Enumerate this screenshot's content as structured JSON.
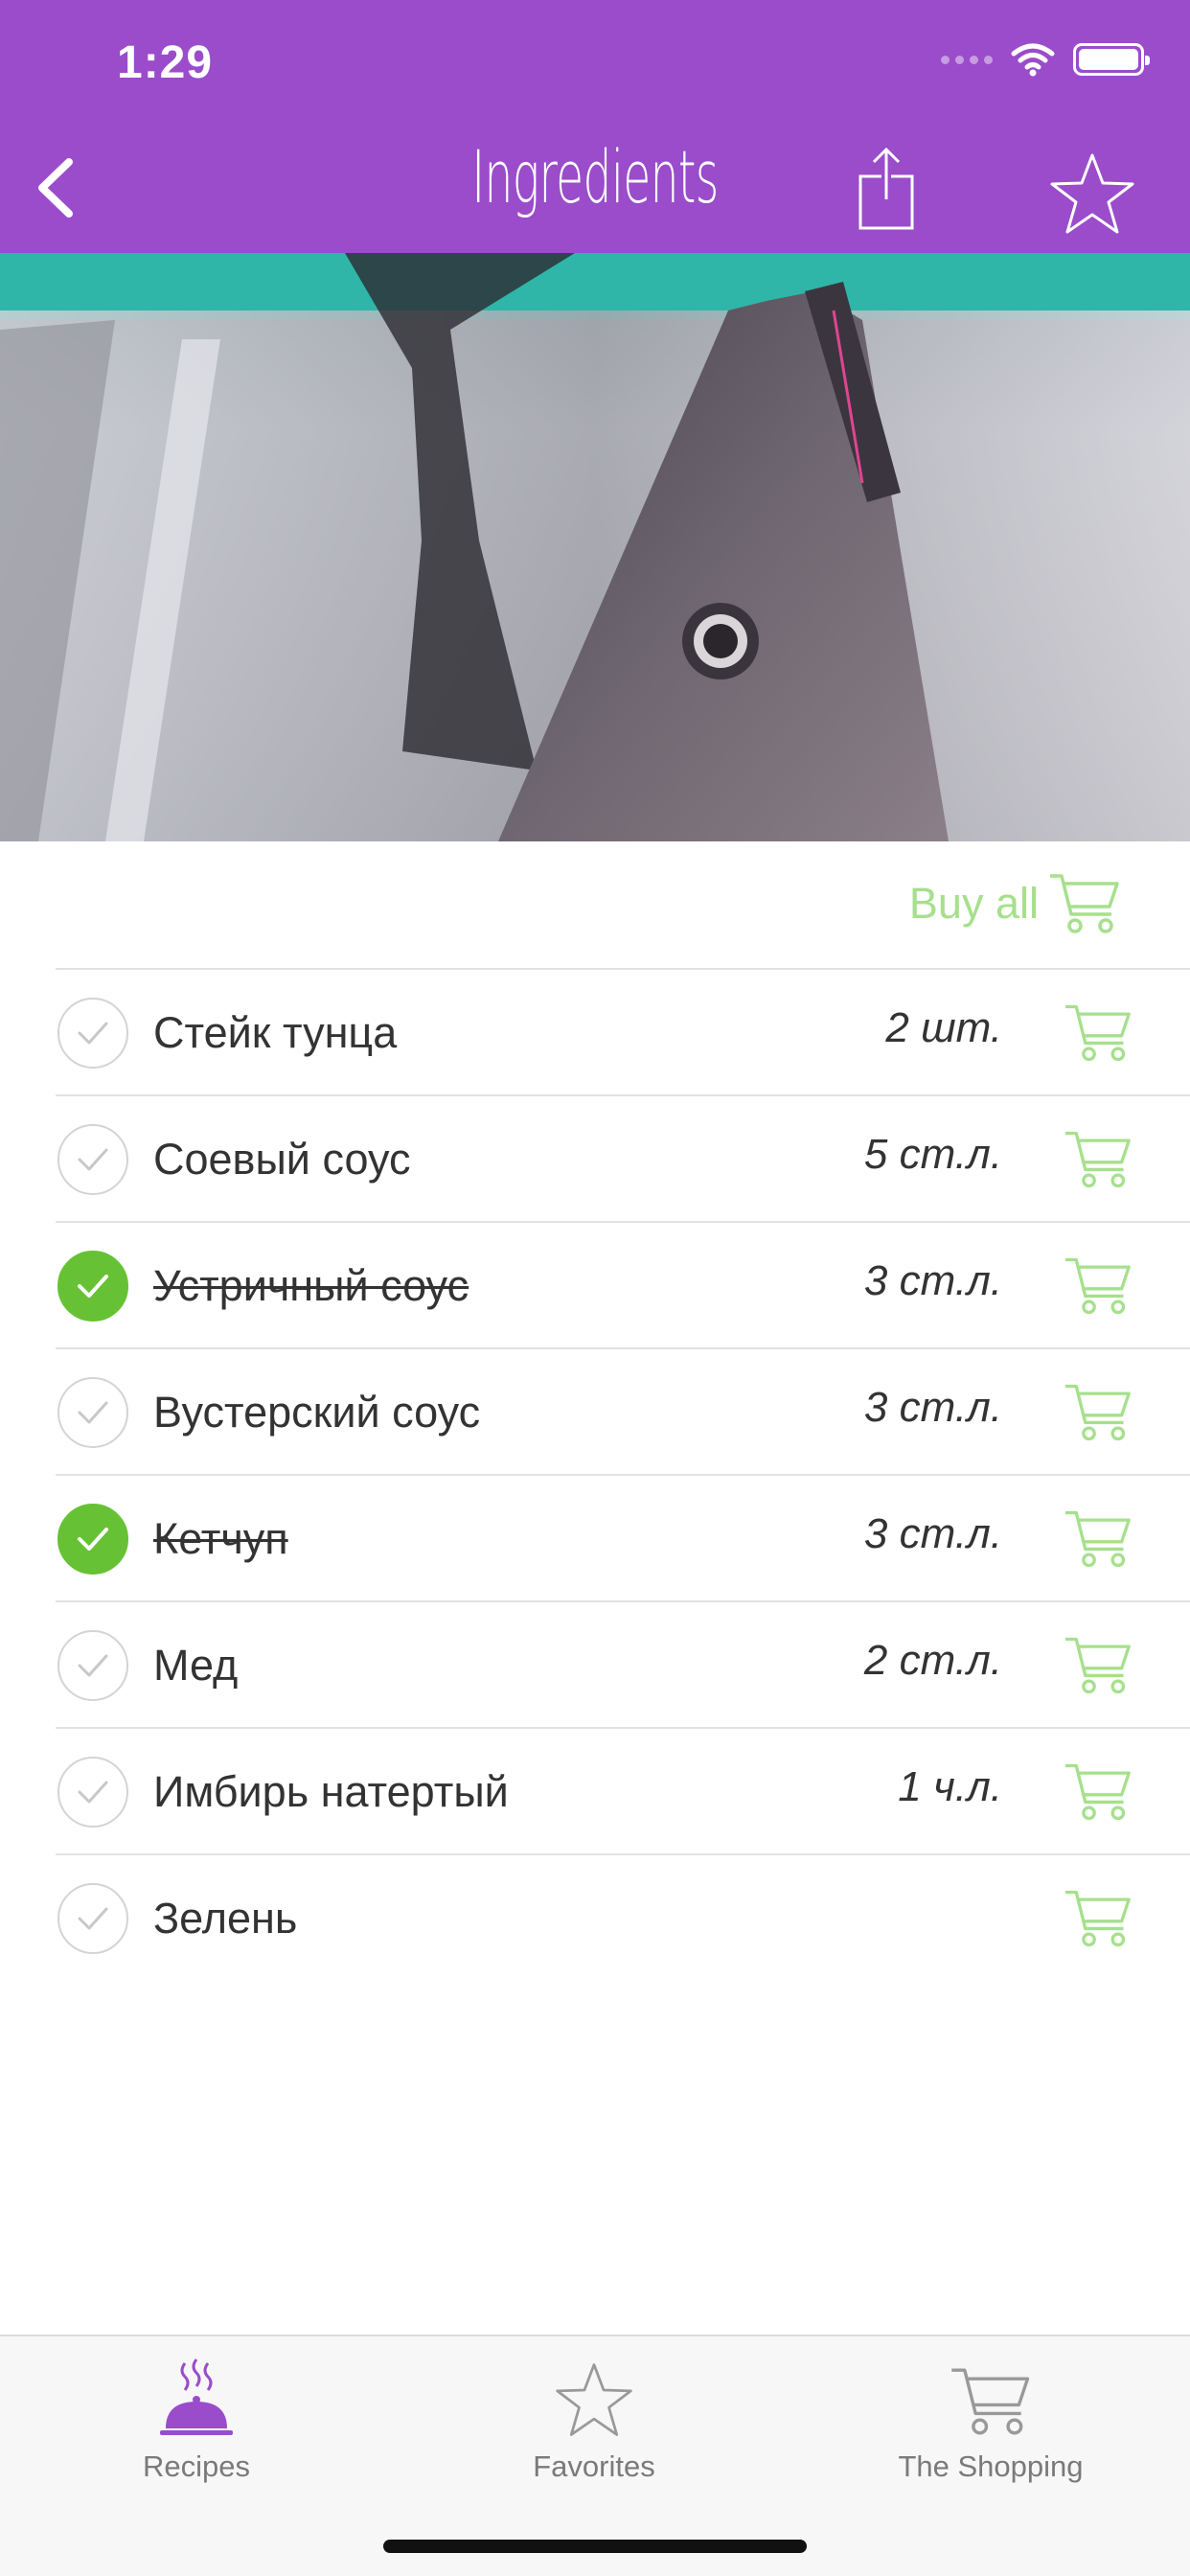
{
  "status_bar": {
    "time": "1:29"
  },
  "nav": {
    "title": "Ingredients"
  },
  "colors": {
    "header": "#9a4ccb",
    "check_done": "#66c234",
    "cart": "#a6e08c"
  },
  "hero": {
    "subject": "tuna-fish-photo"
  },
  "buy_all": {
    "label": "Buy all"
  },
  "ingredients": [
    {
      "name": "Стейк тунца",
      "qty": "2 шт.",
      "checked": false
    },
    {
      "name": "Соевый соус",
      "qty": "5 ст.л.",
      "checked": false
    },
    {
      "name": "Устричный соус",
      "qty": "3 ст.л.",
      "checked": true
    },
    {
      "name": "Вустерский соус",
      "qty": "3 ст.л.",
      "checked": false
    },
    {
      "name": "Кетчуп",
      "qty": "3 ст.л.",
      "checked": true
    },
    {
      "name": "Мед",
      "qty": "2 ст.л.",
      "checked": false
    },
    {
      "name": "Имбирь натертый",
      "qty": "1 ч.л.",
      "checked": false
    },
    {
      "name": "Зелень",
      "qty": "",
      "checked": false
    }
  ],
  "tabs": [
    {
      "label": "Recipes",
      "icon": "cloche-icon",
      "active": true
    },
    {
      "label": "Favorites",
      "icon": "star-icon",
      "active": false
    },
    {
      "label": "The Shopping",
      "icon": "cart-icon",
      "active": false
    }
  ]
}
